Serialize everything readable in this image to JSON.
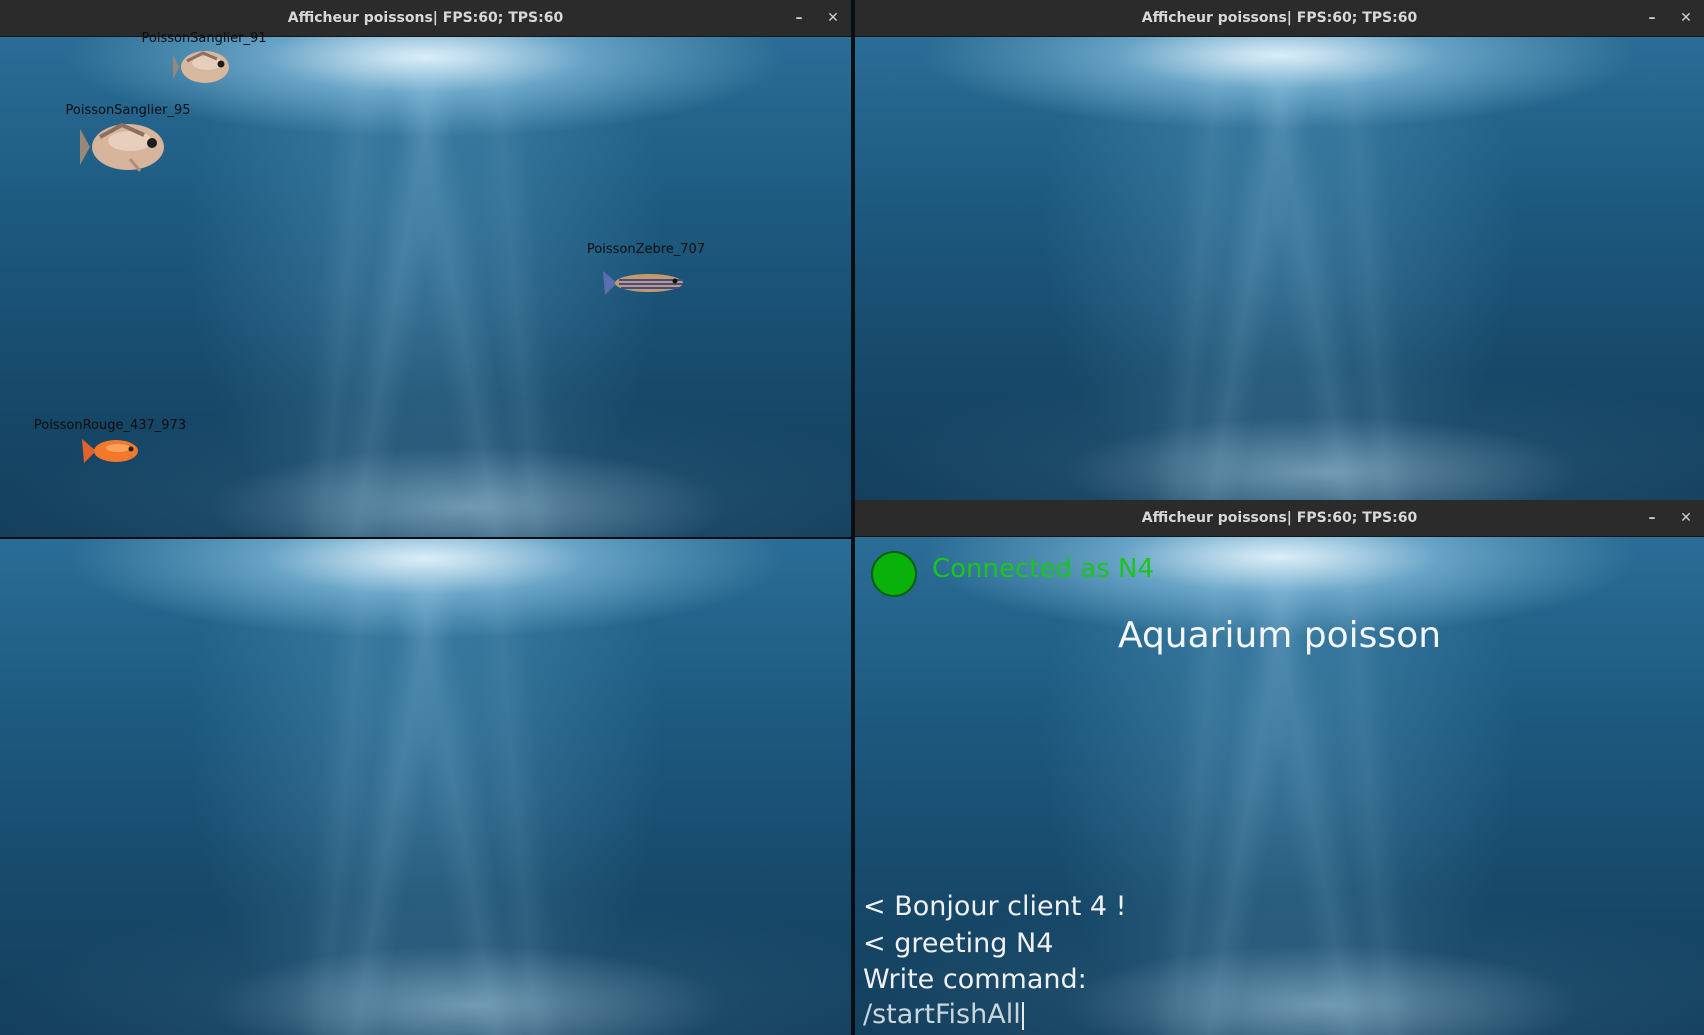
{
  "windows": [
    {
      "title": "Afficheur poissons| FPS:60; TPS:60",
      "fish": [
        {
          "label": "PoissonSanglier_91",
          "kind": "sanglier"
        },
        {
          "label": "PoissonSanglier_95",
          "kind": "sanglier"
        },
        {
          "label": "PoissonZebre_707",
          "kind": "zebre"
        },
        {
          "label": "PoissonRouge_437_973",
          "kind": "rouge"
        }
      ]
    },
    {
      "title": "Afficheur poissons| FPS:60; TPS:60"
    },
    {
      "title": ""
    },
    {
      "title": "Afficheur poissons| FPS:60; TPS:60",
      "status": {
        "text": "Connected as N4",
        "color": "#0bb10b"
      },
      "app_title": "Aquarium poisson",
      "console": {
        "lines": [
          "< Bonjour client 4 !",
          "< greeting N4",
          "Write command:"
        ],
        "input_value": "/startFishAll"
      }
    }
  ],
  "controls": {
    "minimize": "–",
    "close": "✕"
  },
  "icons": {
    "minimize": "minimize-icon",
    "close": "close-icon",
    "status": "status-indicator-icon"
  }
}
